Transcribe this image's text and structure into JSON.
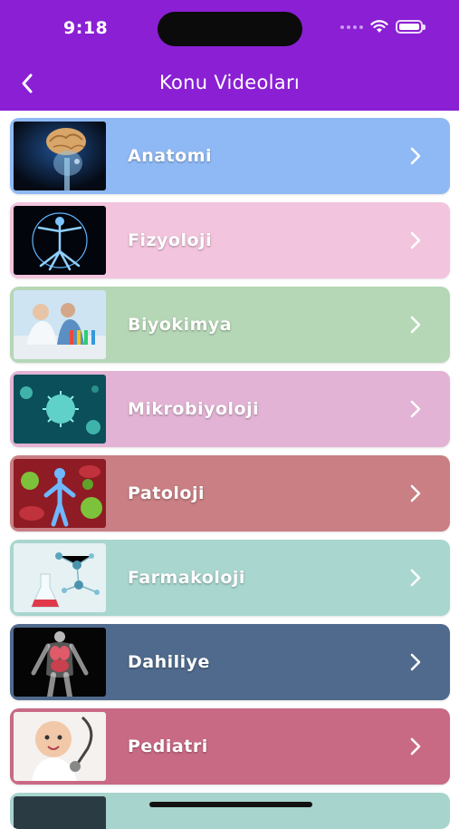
{
  "status_bar": {
    "time": "9:18"
  },
  "header": {
    "title": "Konu Videoları",
    "back_icon": "chevron-left-icon"
  },
  "topics": [
    {
      "label": "Anatomi",
      "color": "#8fb9f5",
      "image": "brain-skeleton-image"
    },
    {
      "label": "Fizyoloji",
      "color": "#f2c4dd",
      "image": "vitruvian-body-image"
    },
    {
      "label": "Biyokimya",
      "color": "#b5d7b6",
      "image": "lab-scientists-image"
    },
    {
      "label": "Mikrobiyoloji",
      "color": "#e2b3d4",
      "image": "virus-image"
    },
    {
      "label": "Patoloji",
      "color": "#c97f83",
      "image": "body-with-pathogens-image"
    },
    {
      "label": "Farmakoloji",
      "color": "#a9d6cf",
      "image": "molecule-flask-image"
    },
    {
      "label": "Dahiliye",
      "color": "#4f6a8c",
      "image": "internal-organs-image"
    },
    {
      "label": "Pediatri",
      "color": "#c96a85",
      "image": "baby-stethoscope-image"
    }
  ],
  "colors": {
    "header_bg": "#8a1fd4",
    "partial_card": "#a7d4cc"
  }
}
